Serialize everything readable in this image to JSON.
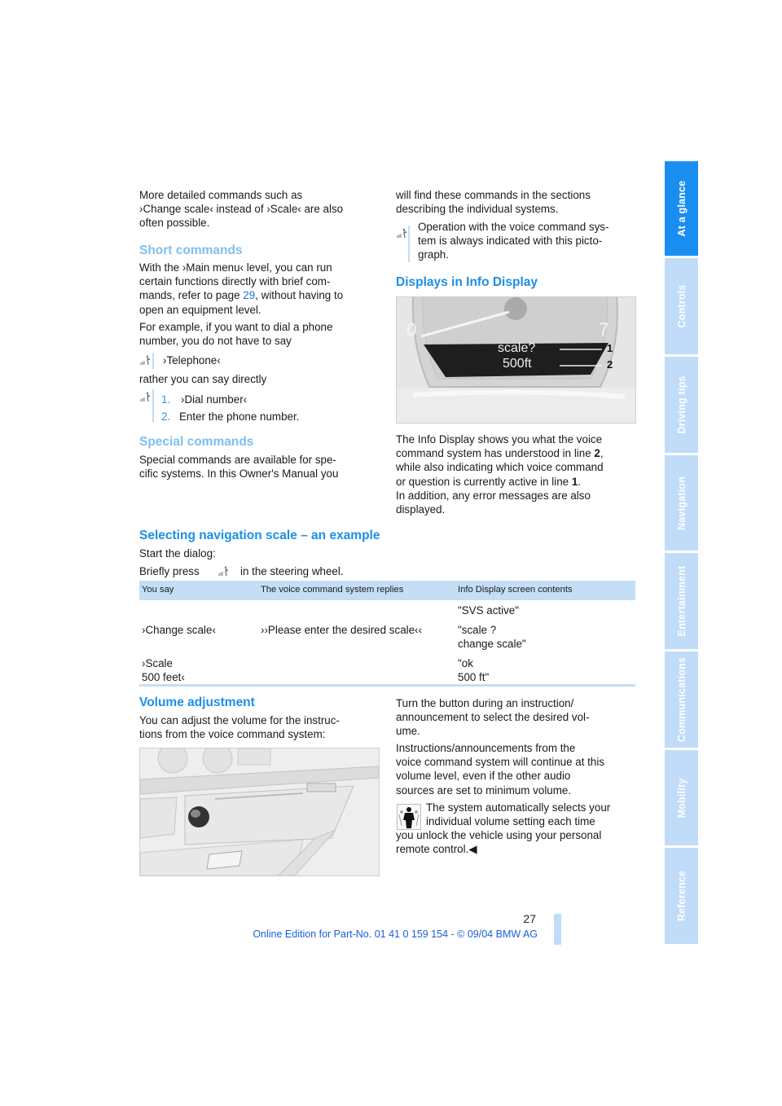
{
  "sidebar": {
    "tabs": [
      {
        "label": "At a glance",
        "active": true
      },
      {
        "label": "Controls",
        "active": false
      },
      {
        "label": "Driving tips",
        "active": false
      },
      {
        "label": "Navigation",
        "active": false
      },
      {
        "label": "Entertainment",
        "active": false
      },
      {
        "label": "Communications",
        "active": false
      },
      {
        "label": "Mobility",
        "active": false
      },
      {
        "label": "Reference",
        "active": false
      }
    ]
  },
  "left_col": {
    "intro": [
      "More detailed commands such as",
      "›Change scale‹ instead of ›Scale‹ are also",
      "often possible."
    ],
    "short_commands": {
      "heading": "Short commands",
      "para1_a": "With the ›Main menu‹ level, you can run",
      "para1_b": "certain functions directly with brief com-",
      "para1_c_pre": "mands, refer to page ",
      "para1_c_link": "29",
      "para1_c_post": ", without having to",
      "para1_d": "open an equipment level.",
      "para2_a": "For example, if you want to dial a phone",
      "para2_b": "number, you do not have to say",
      "voice_example": "›Telephone‹",
      "rather": "rather you can say directly",
      "steps": [
        {
          "num": "1.",
          "text": "›Dial number‹"
        },
        {
          "num": "2.",
          "text": "Enter the phone number."
        }
      ]
    },
    "special_commands": {
      "heading": "Special commands",
      "lines": [
        "Special commands are available for spe-",
        "cific systems. In this Owner's Manual you"
      ]
    }
  },
  "right_col": {
    "cont": [
      "will find these commands in the sections",
      "describing the individual systems."
    ],
    "note": [
      "Operation with the voice command sys-",
      "tem is always indicated with this picto-",
      "graph."
    ],
    "displays": {
      "heading": "Displays in Info Display",
      "figure": {
        "gauge_left": "0",
        "gauge_right": "7",
        "line1": "scale?",
        "line2": "500ft",
        "callout1": "1",
        "callout2": "2"
      },
      "para": {
        "l1": "The Info Display shows you what the voice",
        "l2_pre": "command system has understood in line ",
        "l2_bold": "2",
        "l2_post": ",",
        "l3": "while also indicating which voice command",
        "l4_pre": "or question is currently active in line ",
        "l4_bold": "1",
        "l4_post": ".",
        "l5": "In addition, any error messages are also",
        "l6": "displayed."
      }
    }
  },
  "selecting": {
    "heading": "Selecting navigation scale – an example",
    "start": "Start the dialog:",
    "press_pre": "Briefly press",
    "press_post": "in the steering wheel.",
    "table": {
      "headers": [
        "You say",
        "The voice command system replies",
        "Info Display screen contents"
      ],
      "rows": [
        [
          "",
          "",
          "\"SVS active\""
        ],
        [
          "›Change scale‹",
          "››Please enter the desired scale‹‹",
          "\"scale ?\nchange scale\""
        ],
        [
          "›Scale\n500 feet‹",
          "",
          "\"ok\n500 ft\""
        ]
      ]
    }
  },
  "volume": {
    "heading": "Volume adjustment",
    "intro": [
      "You can adjust the volume for the instruc-",
      "tions from the voice command system:"
    ],
    "right": {
      "p1": [
        "Turn the button during an instruction/",
        "announcement to select the desired vol-",
        "ume."
      ],
      "p2": [
        "Instructions/announcements from the",
        "voice command system will continue at this",
        "volume level, even if the other audio",
        "sources are set to minimum volume."
      ],
      "note_a": "The system automatically selects your",
      "note_b": "individual volume setting each time",
      "note_c": "you unlock the vehicle using your personal",
      "note_d": "remote control.◀"
    }
  },
  "footer": {
    "page_number": "27",
    "edition": "Online Edition for Part-No. 01 41 0 159 154 - © 09/04 BMW AG"
  },
  "colors": {
    "accent_blue": "#1c8fe6",
    "light_heading": "#7fbff0",
    "tab_active": "#1a8ef0",
    "tab_inactive": "#c0dcf8",
    "table_header": "#c4def6"
  }
}
